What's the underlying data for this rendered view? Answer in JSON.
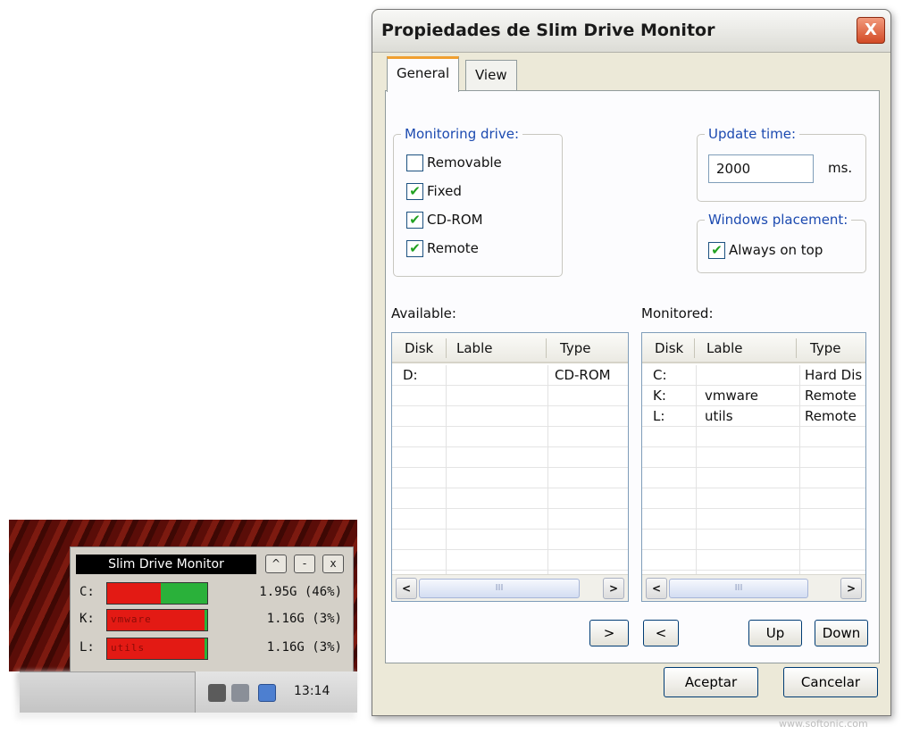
{
  "widget": {
    "title": "Slim Drive Monitor",
    "buttons": [
      "^",
      "-",
      "x"
    ],
    "drives": [
      {
        "letter": "C:",
        "bar_label": "",
        "size": "1.95G (46%)",
        "used_fraction": 0.54
      },
      {
        "letter": "K:",
        "bar_label": "vmware",
        "size": "1.16G (3%)",
        "used_fraction": 0.97
      },
      {
        "letter": "L:",
        "bar_label": "utils",
        "size": "1.16G (3%)",
        "used_fraction": 0.97
      }
    ],
    "clock": "13:14"
  },
  "dialog": {
    "title": "Propiedades de Slim Drive Monitor",
    "close": "X",
    "tabs": [
      "General",
      "View"
    ],
    "monitoring": {
      "title": "Monitoring drive:",
      "options": [
        {
          "label": "Removable",
          "checked": false
        },
        {
          "label": "Fixed",
          "checked": true
        },
        {
          "label": "CD-ROM",
          "checked": true
        },
        {
          "label": "Remote",
          "checked": true
        }
      ]
    },
    "update": {
      "title": "Update time:",
      "value": "2000",
      "unit": "ms."
    },
    "placement": {
      "title": "Windows placement:",
      "always_on_top": "Always on top"
    },
    "available": {
      "label": "Available:",
      "columns": [
        "Disk",
        "Lable",
        "Type"
      ],
      "rows": [
        [
          "D:",
          "",
          "CD-ROM"
        ]
      ]
    },
    "monitored": {
      "label": "Monitored:",
      "columns": [
        "Disk",
        "Lable",
        "Type"
      ],
      "rows": [
        [
          "C:",
          "",
          "Hard Dis"
        ],
        [
          "K:",
          "vmware",
          "Remote"
        ],
        [
          "L:",
          "utils",
          "Remote"
        ]
      ]
    },
    "move_buttons": {
      "add": ">",
      "remove": "<",
      "up": "Up",
      "down": "Down"
    },
    "footer": {
      "ok": "Aceptar",
      "cancel": "Cancelar"
    }
  },
  "scroll": {
    "left": "<",
    "right": ">",
    "thumb": "III"
  },
  "watermark": "www.softonic.com",
  "colors": {
    "used": "#e31a14",
    "free": "#2ab13a",
    "group_title": "#1c4ab0",
    "close": "#d24a26"
  }
}
